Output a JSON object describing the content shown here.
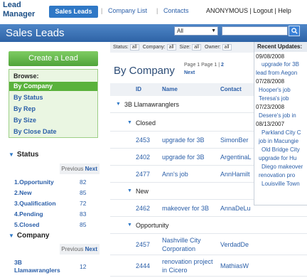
{
  "topnav": {
    "logo_line1": "Lead",
    "logo_line2": "Manager",
    "sales_leads": "Sales Leads",
    "sep": "|",
    "company_list": "Company List",
    "contacts": "Contacts",
    "user_links": "ANONYMOUS | Logout | Help"
  },
  "titlebar": {
    "title": "Sales Leads",
    "filter_value": "All",
    "filter_arrow": "▼",
    "search_placeholder": "",
    "search_icon": "search-icon",
    "search_glyph": "🔍"
  },
  "sidebar": {
    "create_lead": "Create a Lead",
    "browse_title": "Browse:",
    "browse_items": [
      "By Company",
      "By Status",
      "By Rep",
      "By Size",
      "By Close Date"
    ],
    "status_title": "Status",
    "status_pager_prev": "Previous",
    "status_pager_next": "Next",
    "statuses": [
      {
        "label": "1.Opportunity",
        "count": "82"
      },
      {
        "label": "2.New",
        "count": "85"
      },
      {
        "label": "3.Qualification",
        "count": "72"
      },
      {
        "label": "4.Pending",
        "count": "83"
      },
      {
        "label": "5.Closed",
        "count": "85"
      }
    ],
    "company_title": "Company",
    "company_pager_prev": "Previous",
    "company_pager_next": "Next",
    "companies": [
      {
        "label": "3B Llamawranglers",
        "count": "12"
      }
    ]
  },
  "main": {
    "filters": [
      {
        "label": "Status:",
        "value": "all"
      },
      {
        "label": "Company:",
        "value": "all"
      },
      {
        "label": "Size:",
        "value": "all"
      },
      {
        "label": "Owner:",
        "value": "all"
      }
    ],
    "group_title": "By Company",
    "pager_text": "Page  1  Page  1  |",
    "pager_page": "2",
    "pager_next": "Next",
    "columns": {
      "id": "ID",
      "name": "Name",
      "contact": "Contact"
    },
    "company_group": "3B Llamawranglers",
    "groups": [
      {
        "label": "Closed",
        "rows": [
          {
            "id": "2453",
            "name": "upgrade for 3B",
            "contact": "SimonBer"
          },
          {
            "id": "2402",
            "name": "upgrade for 3B",
            "contact": "ArgentinaL"
          },
          {
            "id": "2477",
            "name": "Ann's job",
            "contact": "AnnHamilt"
          }
        ]
      },
      {
        "label": "New",
        "rows": [
          {
            "id": "2462",
            "name": "makeover for 3B",
            "contact": "AnnaDeLu"
          }
        ]
      },
      {
        "label": "Opportunity",
        "rows": [
          {
            "id": "2457",
            "name": "Nashville City Corporation",
            "contact": "VerdadDe"
          },
          {
            "id": "2444",
            "name": "renovation project in Cicero",
            "contact": "MathiasW"
          }
        ]
      }
    ]
  },
  "updates": {
    "title": "Recent Updates:",
    "entries": [
      {
        "date": "09/08/2008",
        "items": [
          "upgrade for 3B",
          "lead from Aegon"
        ]
      },
      {
        "date": "07/28/2008",
        "items": [
          "Hooper's job",
          "Teresa's job"
        ]
      },
      {
        "date": "07/23/2008",
        "items": [
          "Desere's job in"
        ]
      },
      {
        "date": "08/13/2007",
        "items": [
          "Parkland City C",
          "job in Macungie",
          "Old Bridge City",
          "upgrade for Hu",
          "Diego makeover",
          "renovation pro",
          "Louisville Town"
        ]
      }
    ]
  }
}
